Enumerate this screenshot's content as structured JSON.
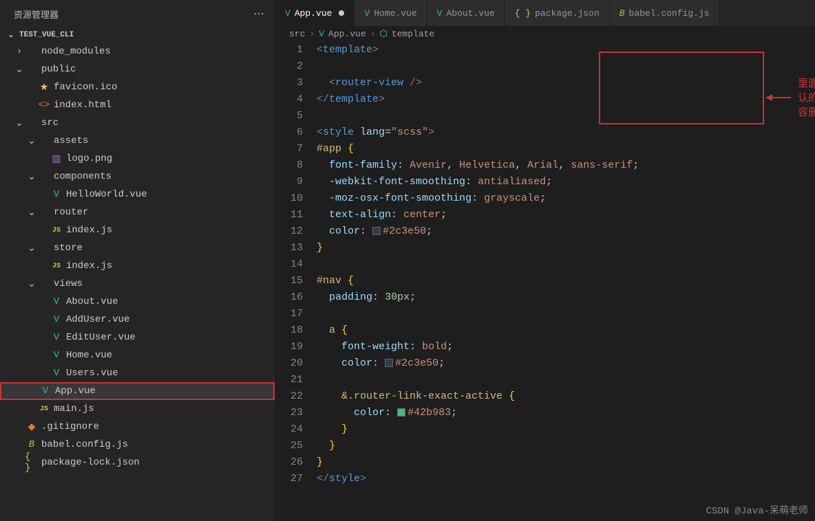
{
  "sidebar": {
    "title": "资源管理器",
    "section": "TEST_VUE_CLI",
    "tree": [
      {
        "depth": 0,
        "chev": "right",
        "icon": "",
        "label": "node_modules"
      },
      {
        "depth": 0,
        "chev": "down",
        "icon": "",
        "label": "public"
      },
      {
        "depth": 1,
        "chev": "",
        "icon": "star",
        "label": "favicon.ico"
      },
      {
        "depth": 1,
        "chev": "",
        "icon": "html",
        "label": "index.html"
      },
      {
        "depth": 0,
        "chev": "down",
        "icon": "",
        "label": "src"
      },
      {
        "depth": 1,
        "chev": "down",
        "icon": "",
        "label": "assets"
      },
      {
        "depth": 2,
        "chev": "",
        "icon": "img",
        "label": "logo.png"
      },
      {
        "depth": 1,
        "chev": "down",
        "icon": "",
        "label": "components"
      },
      {
        "depth": 2,
        "chev": "",
        "icon": "vue",
        "label": "HelloWorld.vue"
      },
      {
        "depth": 1,
        "chev": "down",
        "icon": "",
        "label": "router"
      },
      {
        "depth": 2,
        "chev": "",
        "icon": "js",
        "label": "index.js"
      },
      {
        "depth": 1,
        "chev": "down",
        "icon": "",
        "label": "store"
      },
      {
        "depth": 2,
        "chev": "",
        "icon": "js",
        "label": "index.js"
      },
      {
        "depth": 1,
        "chev": "down",
        "icon": "",
        "label": "views"
      },
      {
        "depth": 2,
        "chev": "",
        "icon": "vue",
        "label": "About.vue"
      },
      {
        "depth": 2,
        "chev": "",
        "icon": "vue",
        "label": "AddUser.vue"
      },
      {
        "depth": 2,
        "chev": "",
        "icon": "vue",
        "label": "EditUser.vue"
      },
      {
        "depth": 2,
        "chev": "",
        "icon": "vue",
        "label": "Home.vue"
      },
      {
        "depth": 2,
        "chev": "",
        "icon": "vue",
        "label": "Users.vue"
      },
      {
        "depth": 1,
        "chev": "",
        "icon": "vue",
        "label": "App.vue",
        "selected": true
      },
      {
        "depth": 1,
        "chev": "",
        "icon": "js",
        "label": "main.js"
      },
      {
        "depth": 0,
        "chev": "",
        "icon": "git",
        "label": ".gitignore"
      },
      {
        "depth": 0,
        "chev": "",
        "icon": "babel",
        "label": "babel.config.js"
      },
      {
        "depth": 0,
        "chev": "",
        "icon": "json",
        "label": "package-lock.json"
      }
    ]
  },
  "tabs": [
    {
      "icon": "vue",
      "label": "App.vue",
      "active": true,
      "modified": true
    },
    {
      "icon": "vue",
      "label": "Home.vue"
    },
    {
      "icon": "vue",
      "label": "About.vue"
    },
    {
      "icon": "json",
      "label": "package.json"
    },
    {
      "icon": "babel",
      "label": "babel.config.js"
    }
  ],
  "breadcrumb": {
    "src": "src",
    "file": "App.vue",
    "sym": "template"
  },
  "annotation": "里面默认的内容删除",
  "watermark": "CSDN @Java-呆萌老师",
  "code_colors": {
    "c1": "#2c3e50",
    "c2": "#42b983"
  }
}
